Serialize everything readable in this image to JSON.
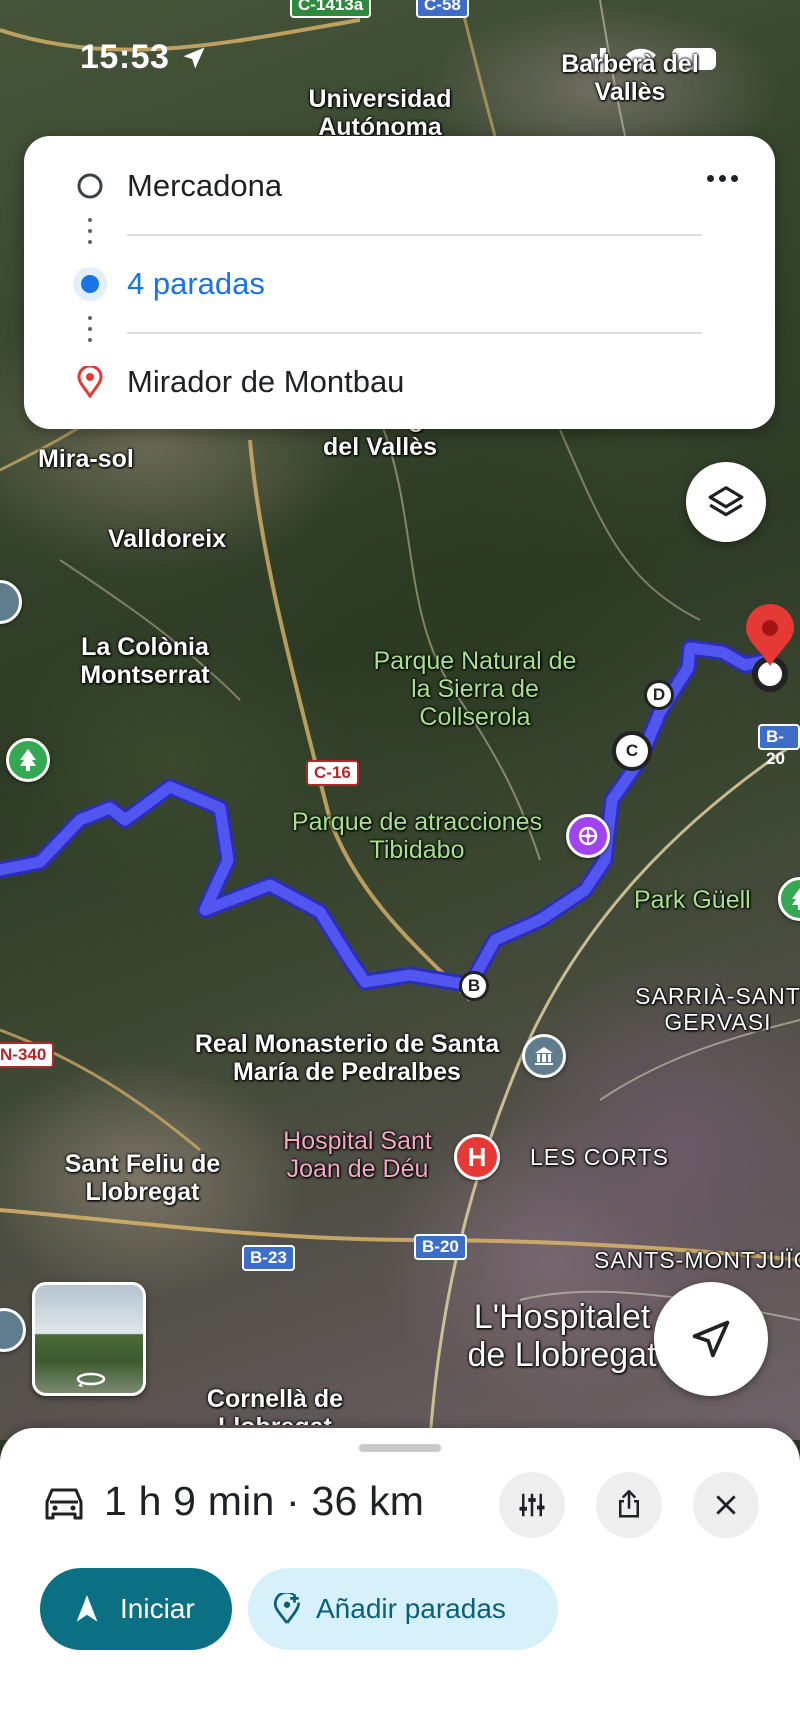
{
  "status_bar": {
    "time": "15:53"
  },
  "map": {
    "labels": {
      "universidad": "Universidad Autónoma",
      "barbera": "Barberà del Vallès",
      "mira_sol": "Mira-sol",
      "sant_cugat": "Sant Cugat del Vallès",
      "valldoreix": "Valldoreix",
      "colonia": "La Colònia Montserrat",
      "collserola": "Parque Natural de la Sierra de Collserola",
      "tibidabo": "Parque de atracciones Tibidabo",
      "park_guell": "Park Güell",
      "sarria": "SARRIÀ-SANT GERVASI",
      "pedralbes": "Real Monasterio de Santa María de Pedralbes",
      "hospital": "Hospital Sant Joan de Déu",
      "les_corts": "LES CORTS",
      "sant_feliu": "Sant Feliu de Llobregat",
      "hospitalet": "L'Hospitalet de Llobregat",
      "sants": "SANTS-MONTJUÏC",
      "cornella": "Cornellà de Llobregat"
    },
    "shields": {
      "c1413a": "C-1413a",
      "c58": "C-58",
      "c16": "C-16",
      "b20_top": "B-20",
      "b20_bottom": "B-20",
      "b23": "B-23",
      "n340": "N-340"
    },
    "stops": {
      "b": "B",
      "c": "C",
      "d": "D"
    }
  },
  "route_card": {
    "origin": "Mercadona",
    "stops": "4 paradas",
    "destination": "Mirador de Montbau"
  },
  "bottom_sheet": {
    "summary": "1 h 9 min · 36 km",
    "start_label": "Iniciar",
    "add_stops_label": "Añadir paradas"
  },
  "colors": {
    "route": "#4a4fe8",
    "primary": "#0b7083",
    "secondary_bg": "#d7f1fb",
    "link_blue": "#1a73e8",
    "destination_red": "#e53935"
  }
}
